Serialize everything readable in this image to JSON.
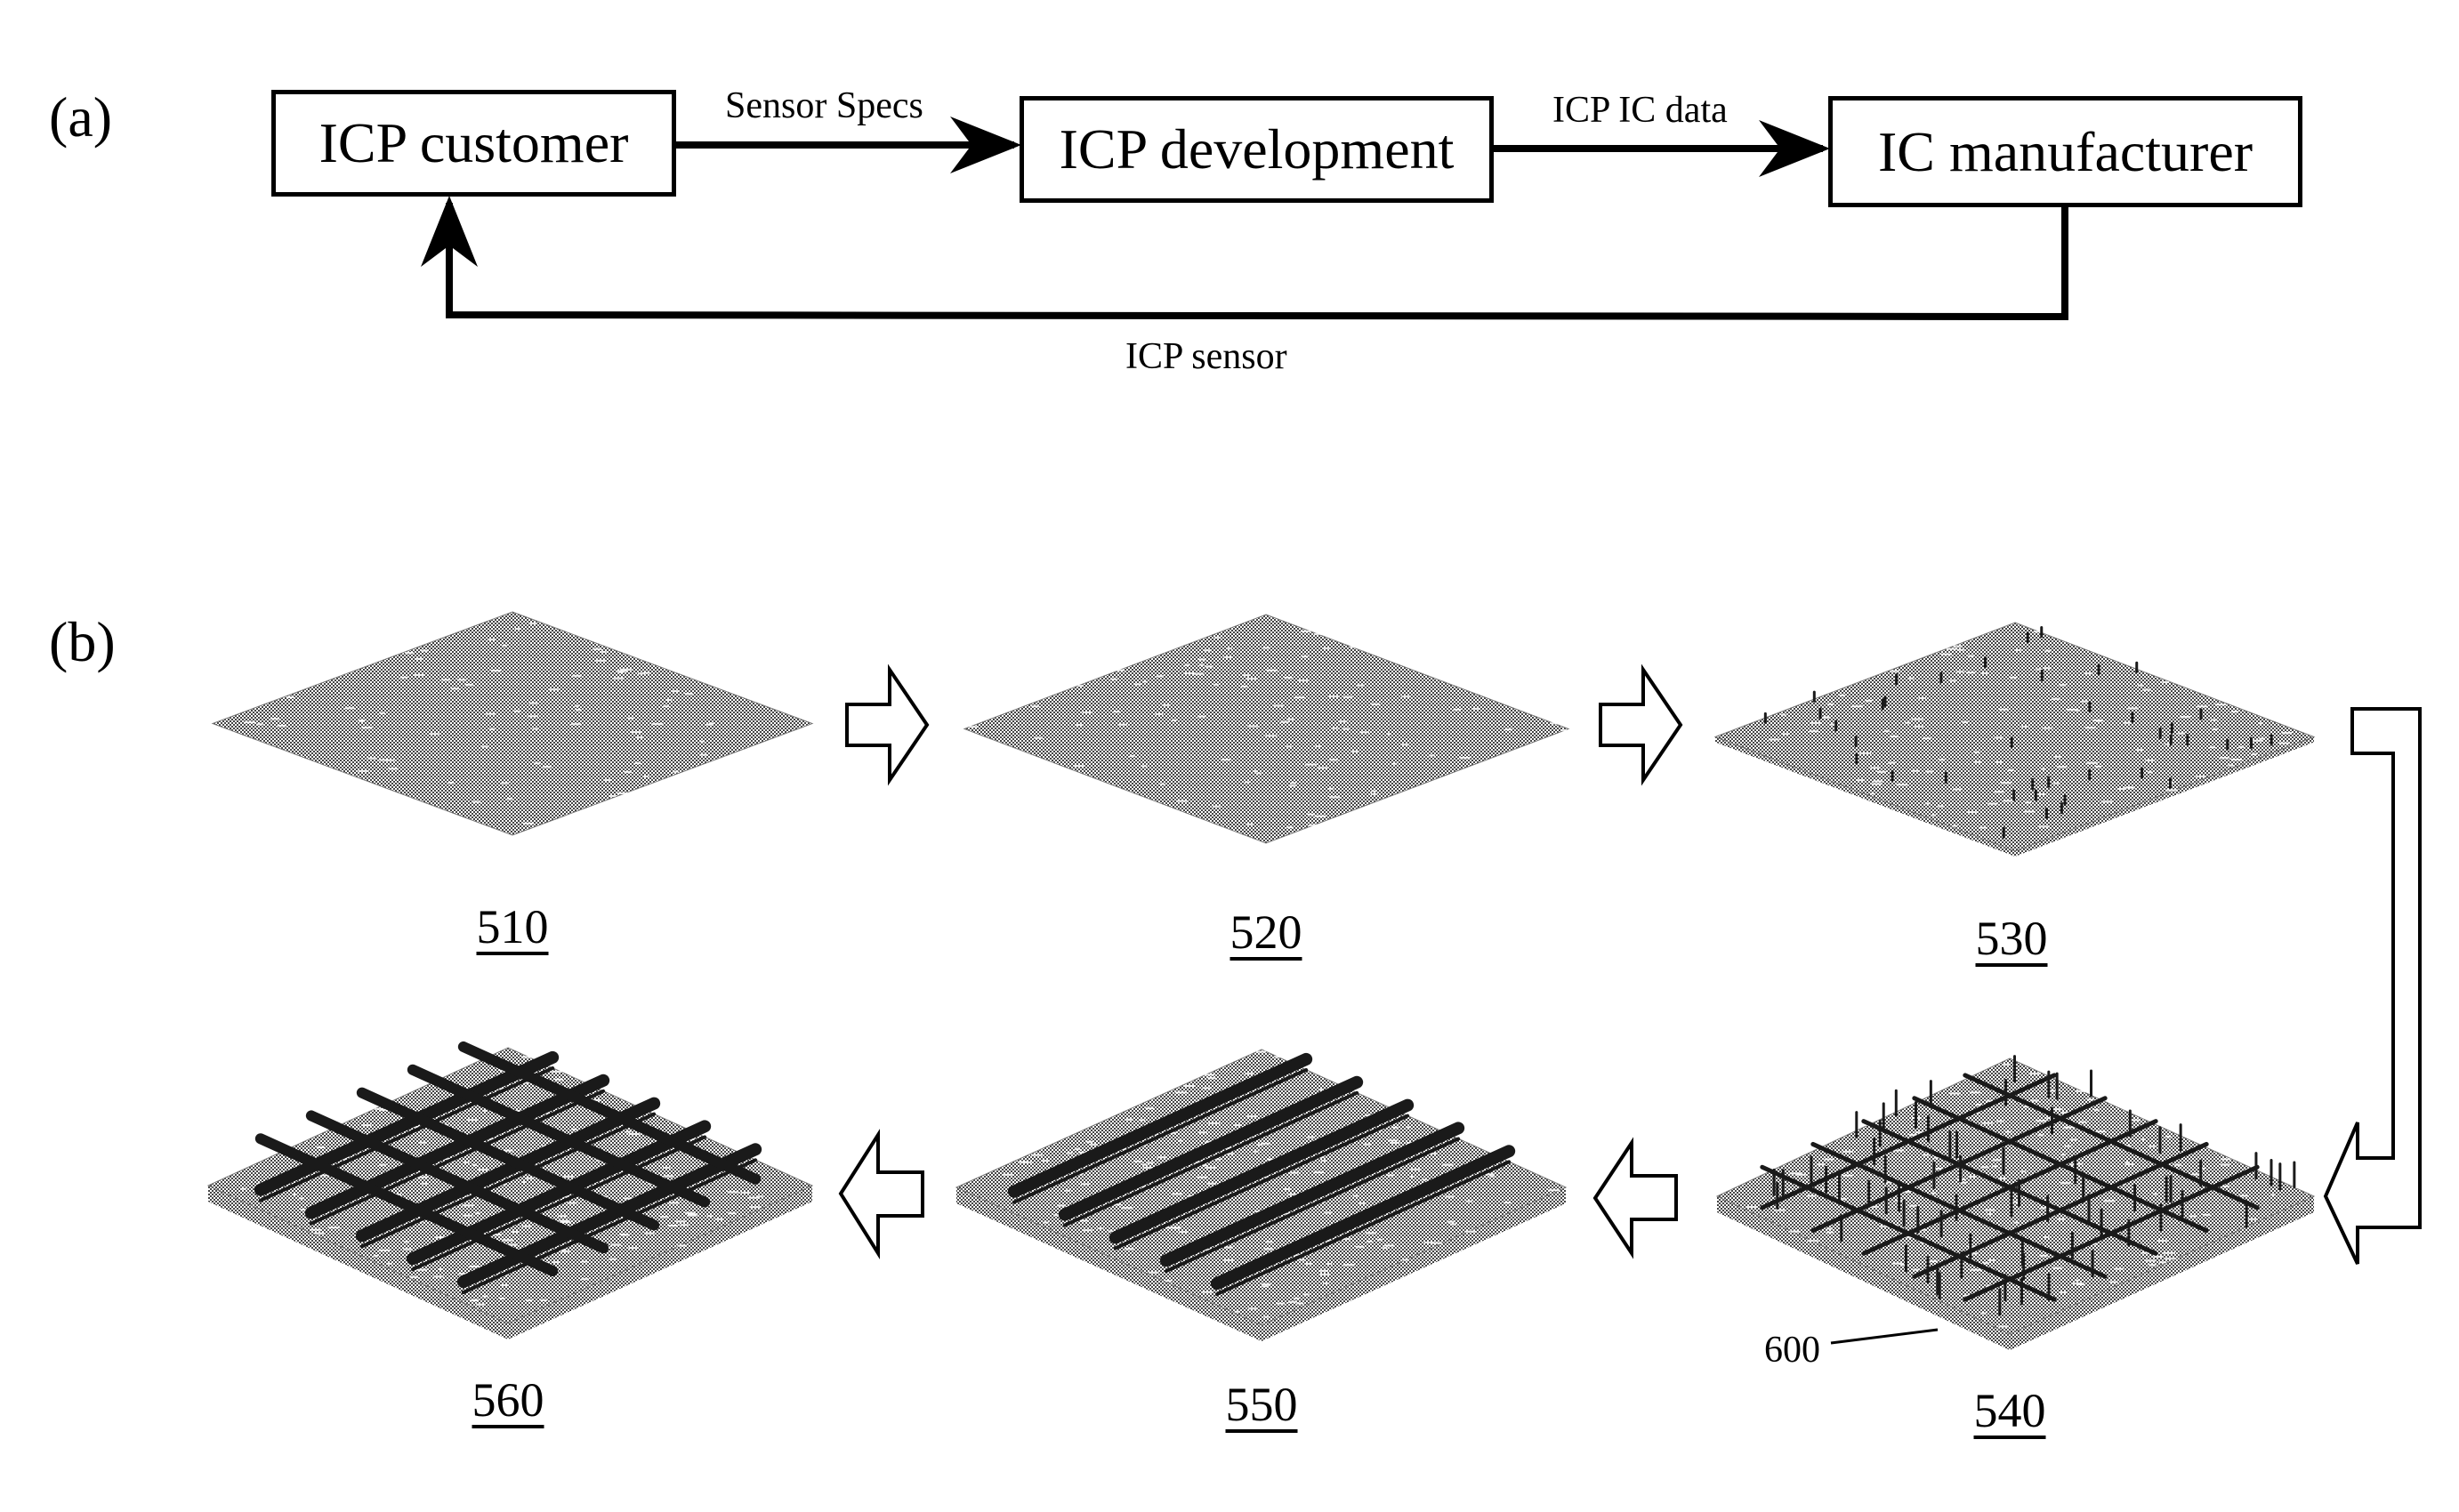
{
  "panel_a": {
    "label": "(a)",
    "nodes": [
      {
        "id": "customer",
        "label": "ICP customer"
      },
      {
        "id": "development",
        "label": "ICP development"
      },
      {
        "id": "manufacturer",
        "label": "IC manufacturer"
      }
    ],
    "edges": [
      {
        "from": "customer",
        "to": "development",
        "label": "Sensor Specs"
      },
      {
        "from": "development",
        "to": "manufacturer",
        "label": "ICP IC data"
      },
      {
        "from": "manufacturer",
        "to": "customer",
        "label": "ICP sensor"
      }
    ]
  },
  "panel_b": {
    "label": "(b)",
    "stages": [
      {
        "ref": "510",
        "density": 0.35,
        "structure": "flat"
      },
      {
        "ref": "520",
        "density": 0.42,
        "structure": "flat"
      },
      {
        "ref": "530",
        "density": 0.55,
        "structure": "posts"
      },
      {
        "ref": "540",
        "density": 0.7,
        "structure": "mesh"
      },
      {
        "ref": "550",
        "density": 0.8,
        "structure": "rails"
      },
      {
        "ref": "560",
        "density": 0.85,
        "structure": "grid"
      }
    ],
    "callout": {
      "label": "600",
      "target": "540"
    },
    "flow_order": [
      "510",
      "520",
      "530",
      "540",
      "550",
      "560"
    ]
  }
}
